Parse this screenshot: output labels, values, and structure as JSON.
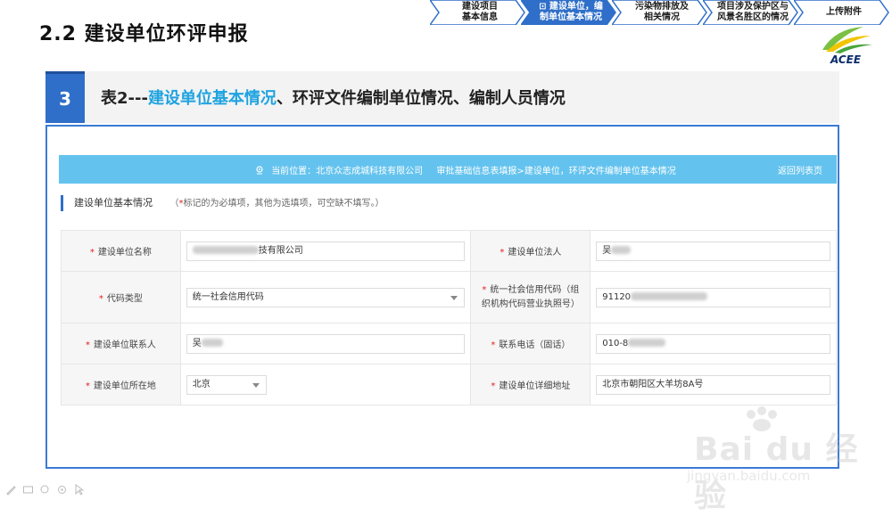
{
  "slide": {
    "title": "2.2  建设单位环评申报"
  },
  "steps": [
    {
      "line1": "建设项目",
      "line2": "基本信息",
      "active": false
    },
    {
      "line1": "⊡ 建设单位，编",
      "line2": "制单位基本情况",
      "active": true
    },
    {
      "line1": "污染物排放及",
      "line2": "相关情况",
      "active": false
    },
    {
      "line1": "项目涉及保护区与",
      "line2": "风景名胜区的情况",
      "active": false
    },
    {
      "line1": "上传附件",
      "line2": "",
      "active": false
    }
  ],
  "logo": {
    "text": "ACEE"
  },
  "section": {
    "number": "3",
    "title_prefix": "表2---",
    "title_highlight": "建设单位基本情况",
    "title_rest": "、环评文件编制单位情况、编制人员情况"
  },
  "app": {
    "location_label": "当前位置：北京众志成城科技有限公司",
    "location_path": "审批基础信息表填报>建设单位，环评文件编制单位基本情况",
    "back_link": "返回列表页",
    "subhead": "建设单位基本情况",
    "note_open": "（",
    "note_star": "*",
    "note_text": "标记的为必填项，其他为选填项，可空缺不填写。）"
  },
  "form": {
    "name_label": "建设单位名称",
    "name_value": "技有限公司",
    "legal_label": "建设单位法人",
    "legal_value": "吴",
    "code_type_label": "代码类型",
    "code_type_value": "统一社会信用代码",
    "credit_label_1": "统一社会信用代码（组",
    "credit_label_2": "织机构代码营业执照号）",
    "credit_value": "91120",
    "contact_label": "建设单位联系人",
    "contact_value": "吴",
    "phone_label": "联系电话（固话）",
    "phone_value": "010-8",
    "region_label": "建设单位所在地",
    "region_value": "北京",
    "address_label": "建设单位详细地址",
    "address_value": "北京市朝阳区大羊坊8A号"
  },
  "watermark": {
    "brand": "Bai du 经验",
    "url": "jingyan.baidu.com"
  },
  "colors": {
    "accent": "#2f6fc9",
    "bar": "#64c3ee",
    "highlight": "#1fa3e0",
    "required": "#e02020"
  }
}
